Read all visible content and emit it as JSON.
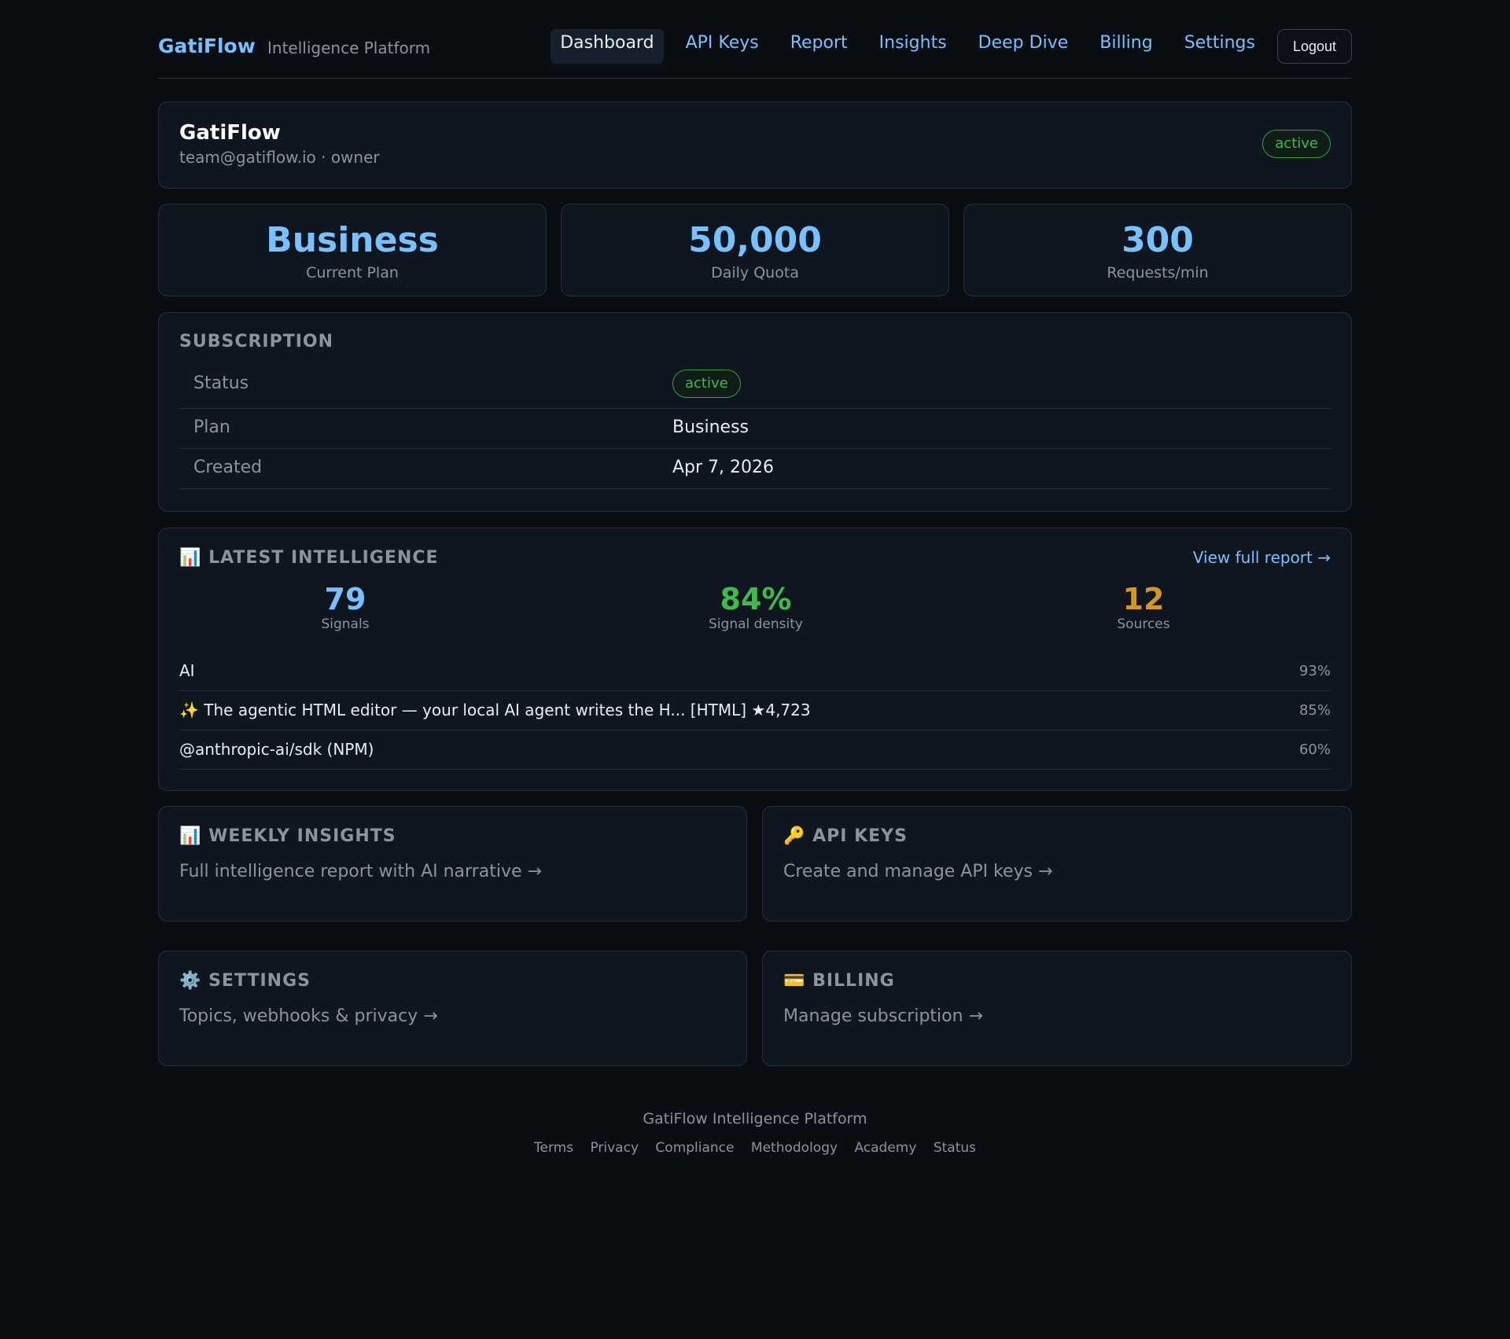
{
  "header": {
    "brand": "GatiFlow",
    "brand_sub": "Intelligence Platform",
    "nav": [
      "Dashboard",
      "API Keys",
      "Report",
      "Insights",
      "Deep Dive",
      "Billing",
      "Settings"
    ],
    "active_nav": "Dashboard",
    "logout": "Logout"
  },
  "account": {
    "name": "GatiFlow",
    "subtitle": "team@gatiflow.io · owner",
    "status": "active"
  },
  "stats": [
    {
      "value": "Business",
      "label": "Current Plan"
    },
    {
      "value": "50,000",
      "label": "Daily Quota"
    },
    {
      "value": "300",
      "label": "Requests/min"
    }
  ],
  "subscription": {
    "title": "SUBSCRIPTION",
    "rows": [
      {
        "key": "Status",
        "value": "active"
      },
      {
        "key": "Plan",
        "value": "Business"
      },
      {
        "key": "Created",
        "value": "Apr 7, 2026"
      }
    ]
  },
  "intelligence": {
    "title": "LATEST INTELLIGENCE",
    "link": "View full report →",
    "metrics": [
      {
        "value": "79",
        "label": "Signals",
        "color": "#79c0ff"
      },
      {
        "value": "84%",
        "label": "Signal density",
        "color": "#3fb950"
      },
      {
        "value": "12",
        "label": "Sources",
        "color": "#d29922"
      }
    ],
    "items": [
      {
        "text": "AI",
        "pct": "93%"
      },
      {
        "text": "✨ The agentic HTML editor — your local AI agent writes the H... [HTML] ★4,723",
        "pct": "85%"
      },
      {
        "text": "@anthropic-ai/sdk (NPM)",
        "pct": "60%"
      }
    ]
  },
  "cards": [
    {
      "icon": "📊",
      "title": "WEEKLY INSIGHTS",
      "desc": "Full intelligence report with AI narrative →"
    },
    {
      "icon": "🔑",
      "title": "API KEYS",
      "desc": "Create and manage API keys →"
    },
    {
      "icon": "⚙️",
      "title": "SETTINGS",
      "desc": "Topics, webhooks & privacy →"
    },
    {
      "icon": "💳",
      "title": "BILLING",
      "desc": "Manage subscription →"
    }
  ],
  "intel_icon": "📊",
  "footer": {
    "title": "GatiFlow Intelligence Platform",
    "links": [
      "Terms",
      "Privacy",
      "Compliance",
      "Methodology",
      "Academy",
      "Status"
    ]
  },
  "colors": {
    "accent": "#79c0ff",
    "success": "#3fb950",
    "warning": "#d29922",
    "background": "#0a0d12",
    "card": "#0f161f"
  }
}
